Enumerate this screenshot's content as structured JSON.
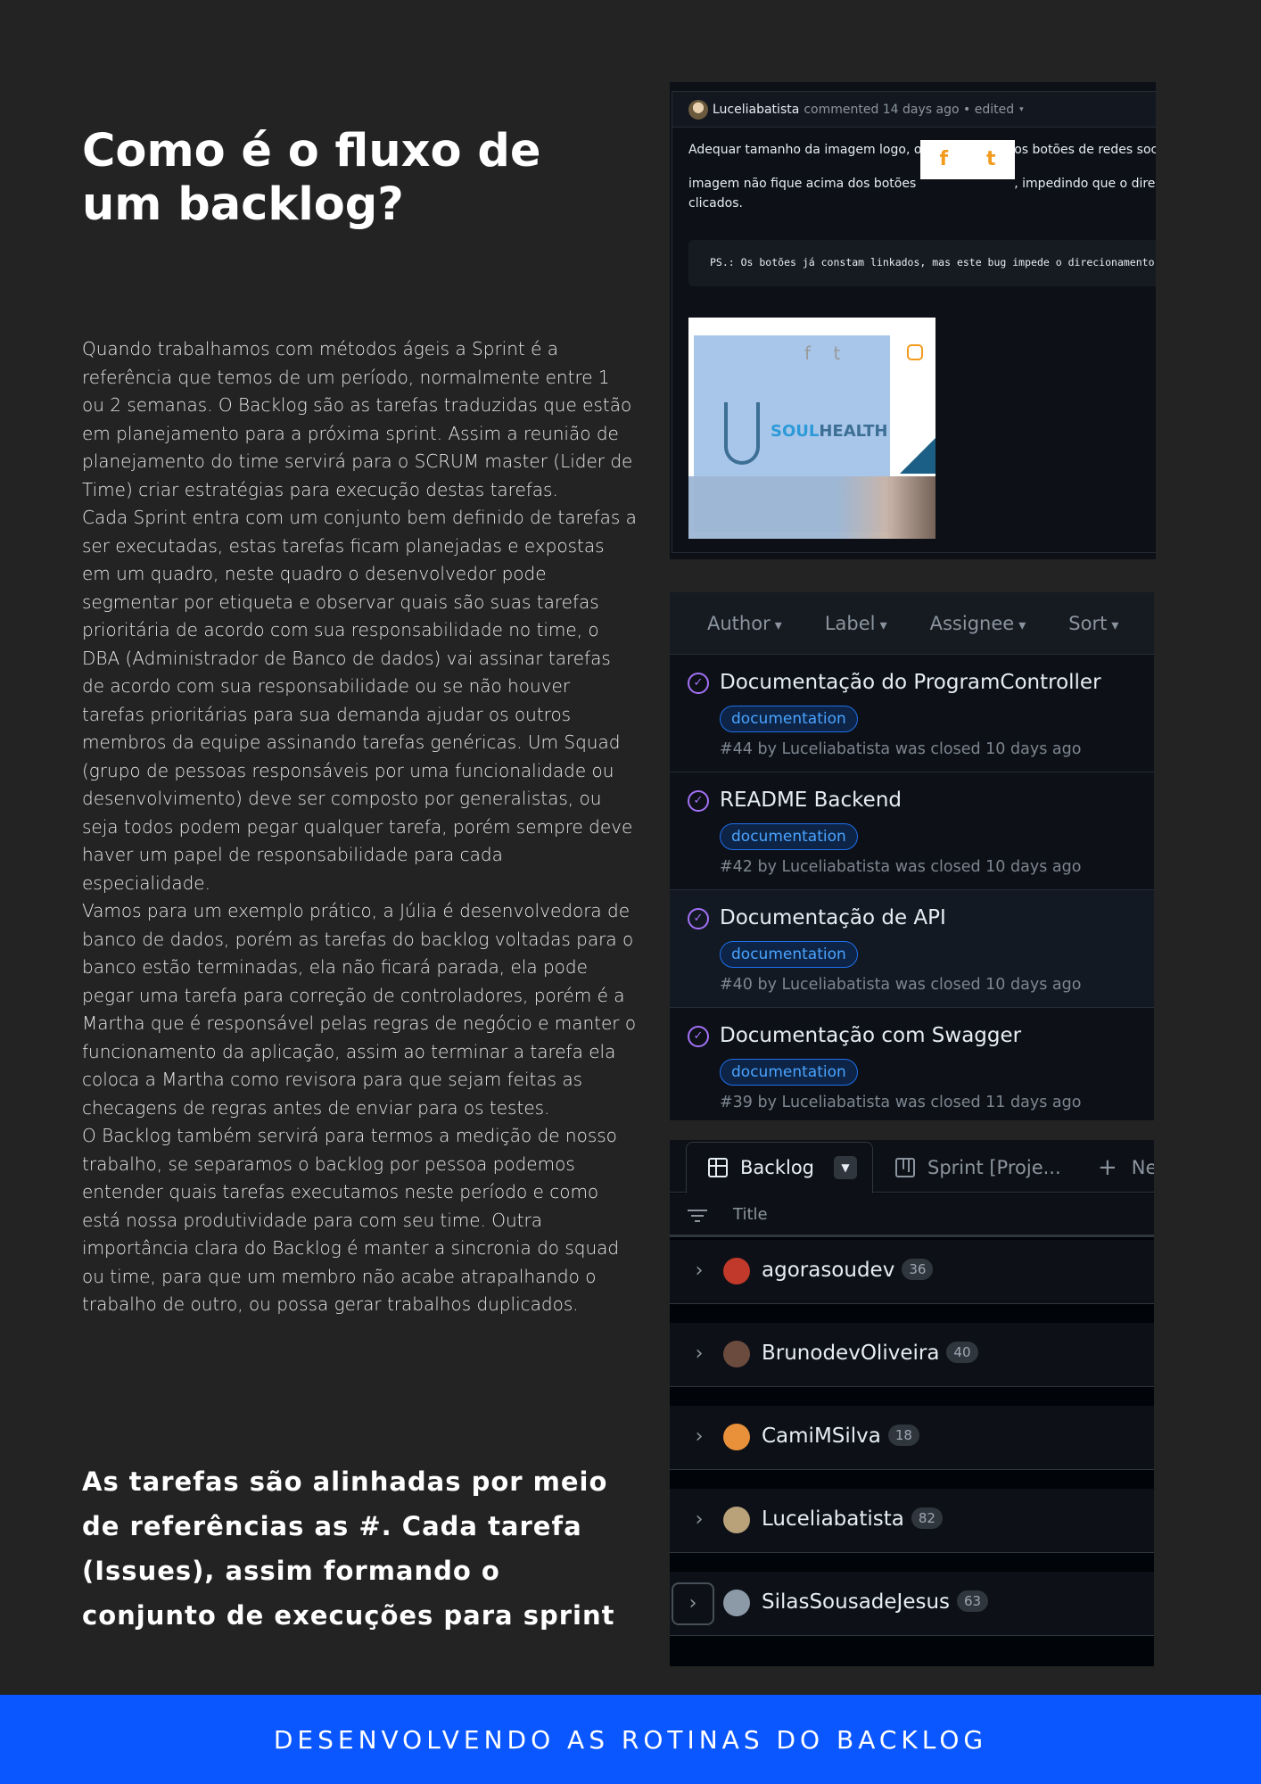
{
  "page": {
    "title": "Como é o fluxo de um backlog?",
    "paragraphs": [
      "Quando trabalhamos com métodos ágeis a Sprint é a referência que temos de um período, normalmente entre 1 ou 2 semanas. O Backlog são as tarefas traduzidas que estão em planejamento para a próxima sprint. Assim a reunião de planejamento do time servirá para o SCRUM master (Lider de Time) criar estratégias para execução destas tarefas.",
      "Cada Sprint entra com um conjunto bem definido de tarefas a ser executadas, estas tarefas ficam planejadas e expostas em um quadro, neste quadro o desenvolvedor pode segmentar por etiqueta e observar quais são suas tarefas prioritária de acordo com sua responsabilidade no time, o DBA (Administrador de Banco de dados) vai assinar tarefas de acordo com sua responsabilidade ou se não houver tarefas prioritárias para sua demanda ajudar os outros membros da equipe assinando tarefas genéricas. Um Squad (grupo de pessoas responsáveis por uma funcionalidade ou desenvolvimento) deve ser composto por generalistas, ou seja todos podem pegar qualquer tarefa, porém sempre deve haver um papel de responsabilidade para cada especialidade.",
      "Vamos para um exemplo prático, a Júlia é desenvolvedora de banco de dados, porém as tarefas do backlog voltadas para o banco estão terminadas, ela não ficará parada, ela pode pegar uma tarefa para correção de controladores, porém é a Martha que é responsável pelas regras de negócio e manter o funcionamento da aplicação, assim ao terminar a tarefa ela coloca a Martha como revisora para que sejam feitas as checagens de regras antes de enviar para os testes.",
      "O Backlog também servirá para termos a medição de nosso trabalho, se separamos o backlog por pessoa podemos entender quais tarefas executamos neste período e como está nossa produtividade para com seu time. Outra importância clara do Backlog é manter a sincronia do squad ou time, para que um membro não acabe atrapalhando o trabalho de outro, ou possa gerar trabalhos duplicados."
    ],
    "highlight": "As tarefas são alinhadas por meio de referências as #. Cada tarefa (Issues), assim formando o conjunto de execuções para sprint",
    "footer": "DESENVOLVENDO AS ROTINAS DO BACKLOG"
  },
  "comment": {
    "user": "Luceliabatista",
    "meta": "commented 14 days ago • edited",
    "caret": "▾",
    "line1": "Adequar tamanho da imagem logo, ou reposicionar os botões de redes sociais",
    "line2a": "imagem não fique acima dos botões",
    "line2b": ", impedindo que o direcionamento",
    "line3": "clicados.",
    "code": "PS.: Os botões já constam linkados, mas este bug impede o direcionamento",
    "social_icons": [
      "f",
      "t"
    ],
    "logo_text_a": "SOUL",
    "logo_text_b": "HEALTH"
  },
  "issues": {
    "filters": [
      "Author",
      "Label",
      "Assignee",
      "Sort"
    ],
    "items": [
      {
        "title": "Documentação do ProgramController",
        "label": "documentation",
        "meta": "#44 by Luceliabatista was closed 10 days ago"
      },
      {
        "title": "README Backend",
        "label": "documentation",
        "meta": "#42 by Luceliabatista was closed 10 days ago"
      },
      {
        "title": "Documentação de API",
        "label": "documentation",
        "meta": "#40 by Luceliabatista was closed 10 days ago"
      },
      {
        "title": "Documentação com Swagger",
        "label": "documentation",
        "meta": "#39 by Luceliabatista was closed 11 days ago"
      }
    ]
  },
  "project": {
    "tabs": {
      "backlog": "Backlog",
      "sprint": "Sprint [Proje...",
      "new_view": "Ne"
    },
    "column_title": "Title",
    "groups": [
      {
        "name": "agorasoudev",
        "count": "36",
        "color": "#c0392b"
      },
      {
        "name": "BrunodevOliveira",
        "count": "40",
        "color": "#6b4b3e"
      },
      {
        "name": "CamiMSilva",
        "count": "18",
        "color": "#e8913a"
      },
      {
        "name": "Luceliabatista",
        "count": "82",
        "color": "#b9a27a"
      },
      {
        "name": "SilasSousadeJesus",
        "count": "63",
        "color": "#8c9aa8"
      }
    ]
  }
}
